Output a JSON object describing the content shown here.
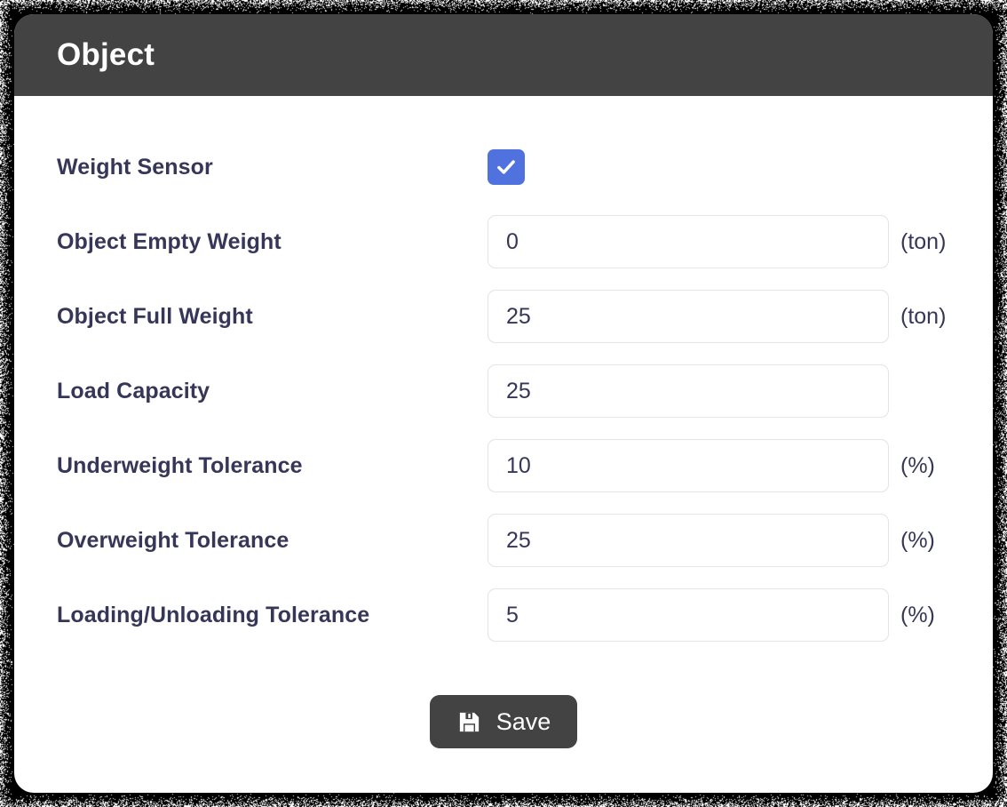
{
  "dialog": {
    "title": "Object",
    "header_color": "#434343",
    "background_color": "#ffffff"
  },
  "form": {
    "rows": [
      {
        "label": "Weight Sensor",
        "type": "checkbox",
        "checked": true,
        "accent_color": "#4f72de",
        "value": "",
        "unit": ""
      },
      {
        "label": "Object Empty Weight",
        "type": "text",
        "value": "0",
        "unit": "(ton)"
      },
      {
        "label": "Object Full Weight",
        "type": "text",
        "value": "25",
        "unit": "(ton)"
      },
      {
        "label": "Load Capacity",
        "type": "text",
        "value": "25",
        "unit": ""
      },
      {
        "label": "Underweight Tolerance",
        "type": "text",
        "value": "10",
        "unit": "(%)"
      },
      {
        "label": "Overweight Tolerance",
        "type": "text",
        "value": "25",
        "unit": "(%)"
      },
      {
        "label": "Loading/Unloading Tolerance",
        "type": "text",
        "value": "5",
        "unit": "(%)"
      }
    ]
  },
  "actions": {
    "save_label": "Save",
    "save_icon": "floppy-disk-icon",
    "save_color": "#434343"
  },
  "icons": {
    "check": "check-icon"
  }
}
